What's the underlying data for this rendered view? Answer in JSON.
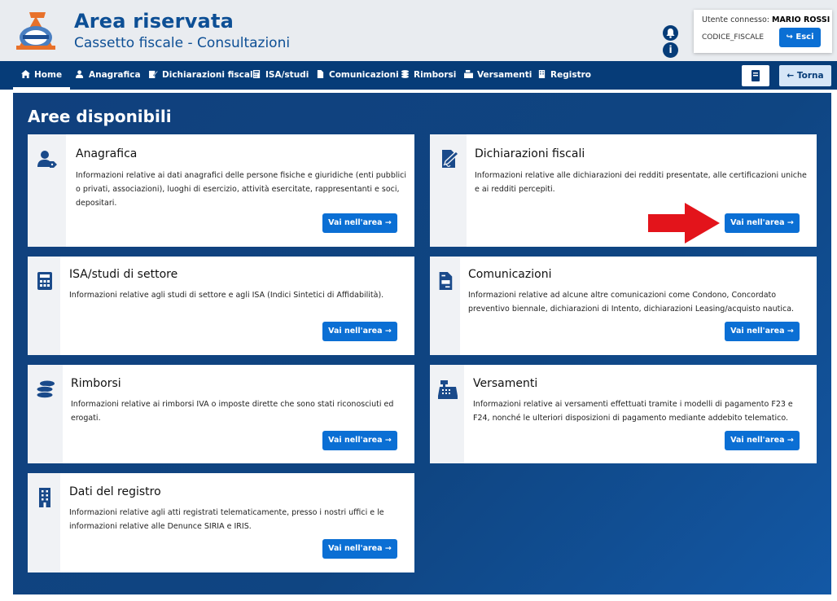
{
  "header": {
    "title": "Area riservata",
    "subtitle": "Cassetto fiscale - Consultazioni",
    "user_label": "Utente connesso:",
    "user_name": "MARIO ROSSI",
    "fiscal_code": "CODICE_FISCALE",
    "logout_label": "Esci"
  },
  "nav": {
    "items": [
      {
        "label": "Home",
        "icon": "home-icon"
      },
      {
        "label": "Anagrafica",
        "icon": "users-icon"
      },
      {
        "label": "Dichiarazioni fiscali",
        "icon": "edit-icon"
      },
      {
        "label": "ISA/studi",
        "icon": "calculator-icon"
      },
      {
        "label": "Comunicazioni",
        "icon": "document-icon"
      },
      {
        "label": "Rimborsi",
        "icon": "coins-icon"
      },
      {
        "label": "Versamenti",
        "icon": "cash-register-icon"
      },
      {
        "label": "Registro",
        "icon": "building-icon"
      }
    ],
    "back_label": "Torna"
  },
  "main": {
    "title": "Aree disponibili",
    "button_label": "Vai nell'area",
    "cards": [
      {
        "title": "Anagrafica",
        "desc": "Informazioni relative ai dati anagrafici delle persone fisiche e giuridiche (enti pubblici o privati, associazioni), luoghi di esercizio, attività esercitate, rappresentanti e soci, depositari.",
        "icon": "user-tag-icon"
      },
      {
        "title": "Dichiarazioni fiscali",
        "desc": "Informazioni relative alle dichiarazioni dei redditi presentate, alle certificazioni uniche e ai redditi percepiti.",
        "icon": "signature-icon"
      },
      {
        "title": "ISA/studi di settore",
        "desc": "Informazioni relative agli studi di settore e agli ISA (Indici Sintetici di Affidabilità).",
        "icon": "calculator-icon"
      },
      {
        "title": "Comunicazioni",
        "desc": "Informazioni relative ad alcune altre comunicazioni come Condono, Concordato preventivo biennale, dichiarazioni di Intento, dichiarazioni Leasing/acquisto nautica.",
        "icon": "file-invoice-icon"
      },
      {
        "title": "Rimborsi",
        "desc": "Informazioni relative ai rimborsi IVA o imposte dirette che sono stati riconosciuti ed erogati.",
        "icon": "coins-icon"
      },
      {
        "title": "Versamenti",
        "desc": "Informazioni relative ai versamenti effettuati tramite i modelli di pagamento F23 e F24, nonché le ulteriori disposizioni di pagamento mediante addebito telematico.",
        "icon": "cash-register-icon"
      },
      {
        "title": "Dati del registro",
        "desc": "Informazioni relative agli atti registrati telematicamente, presso i nostri uffici e le informazioni relative alle Denunce SIRIA e IRIS.",
        "icon": "building-icon"
      }
    ]
  },
  "colors": {
    "brand_blue": "#063c78",
    "button_blue": "#0b6fd4",
    "annotation_red": "#e3141b"
  }
}
